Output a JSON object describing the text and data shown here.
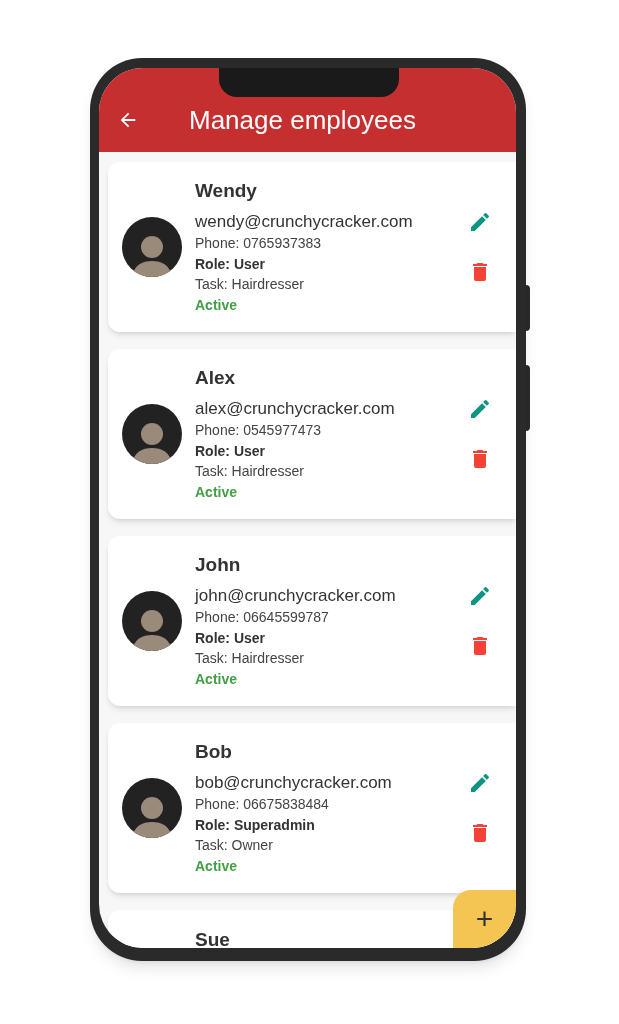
{
  "app_bar": {
    "title": "Manage employees"
  },
  "employees": [
    {
      "name": "Wendy",
      "email": "wendy@crunchycracker.com",
      "phone": "Phone: 0765937383",
      "role": "Role: User",
      "task": "Task: Hairdresser",
      "status": "Active"
    },
    {
      "name": "Alex",
      "email": "alex@crunchycracker.com",
      "phone": "Phone: 0545977473",
      "role": "Role: User",
      "task": "Task: Hairdresser",
      "status": "Active"
    },
    {
      "name": "John",
      "email": "john@crunchycracker.com",
      "phone": "Phone: 06645599787",
      "role": "Role: User",
      "task": "Task: Hairdresser",
      "status": "Active"
    },
    {
      "name": "Bob",
      "email": "bob@crunchycracker.com",
      "phone": "Phone: 06675838484",
      "role": "Role: Superadmin",
      "task": "Task: Owner",
      "status": "Active"
    },
    {
      "name": "Sue"
    }
  ],
  "fab": {
    "label": "+"
  }
}
